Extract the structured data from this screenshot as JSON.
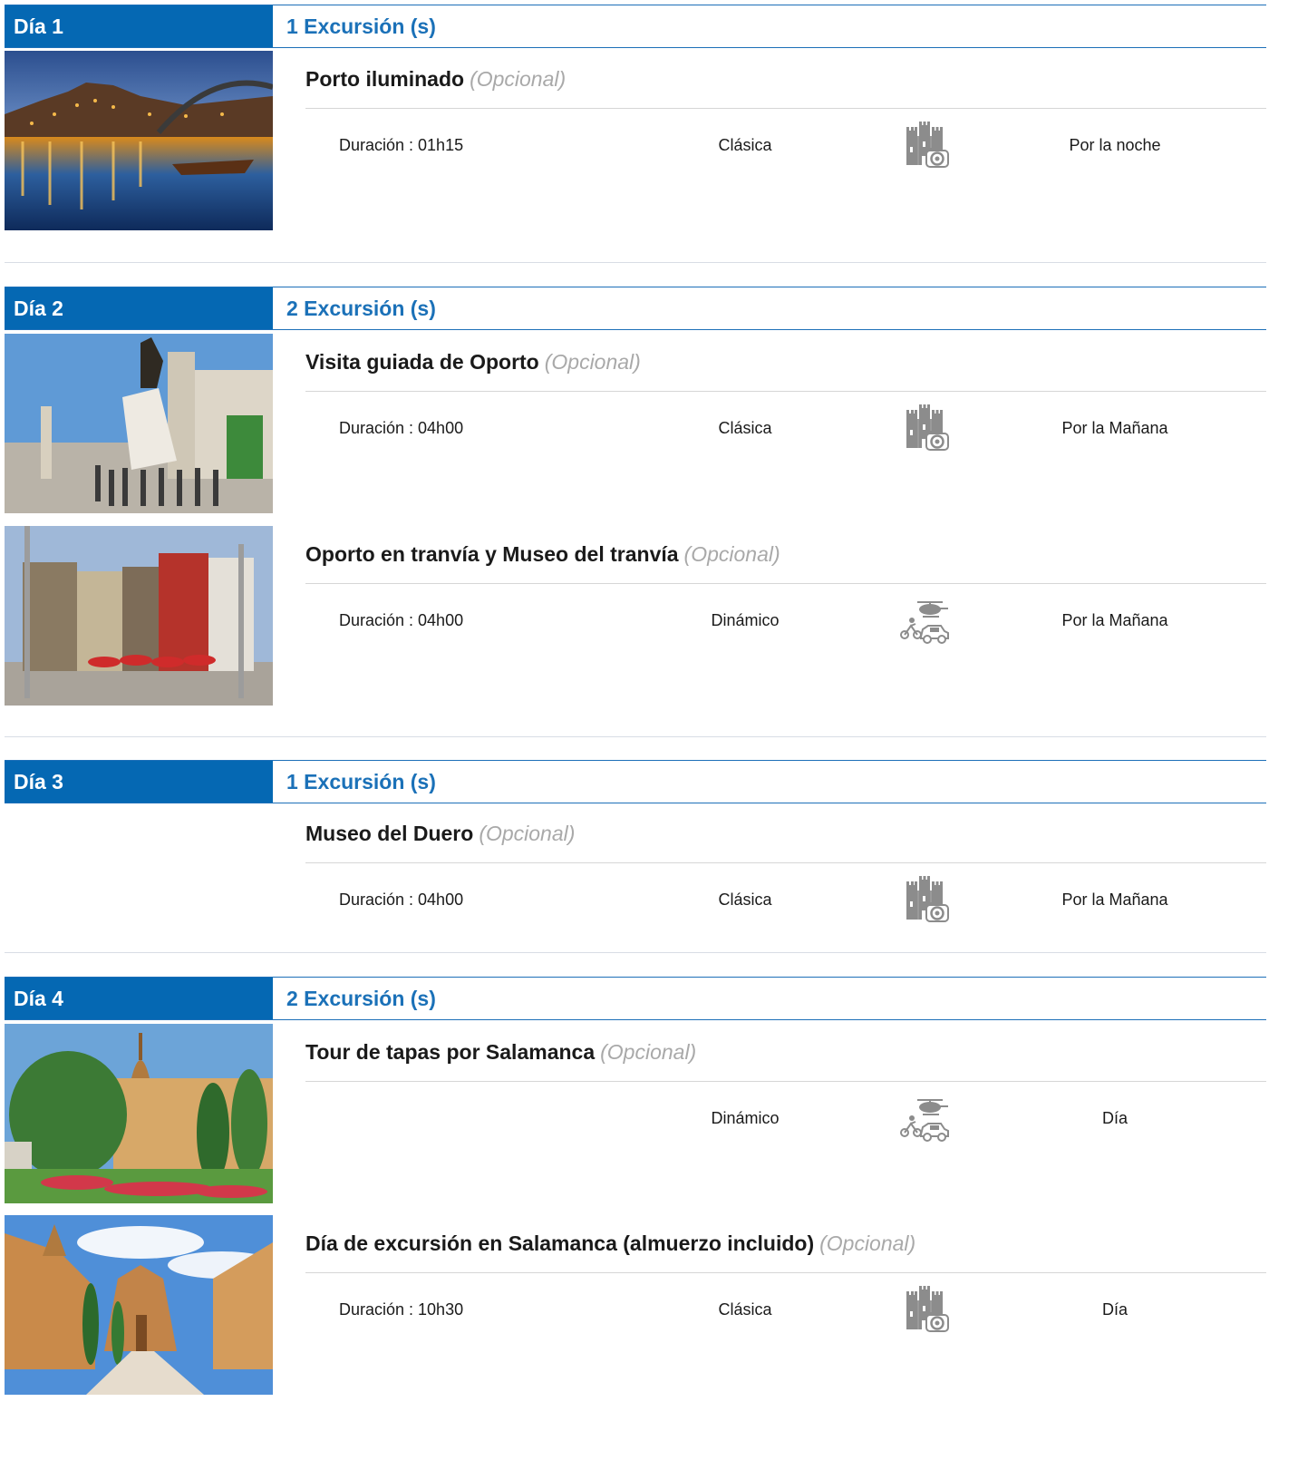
{
  "days": [
    {
      "label": "Día 1",
      "count": "1 Excursión (s)",
      "excursions": [
        {
          "name": "Porto iluminado",
          "optional": "(Opcional)",
          "duration": "Duración : 01h15",
          "category": "Clásica",
          "icon": "castle-camera-icon",
          "time": "Por la noche",
          "image": "porto-night"
        }
      ]
    },
    {
      "label": "Día 2",
      "count": "2 Excursión (s)",
      "excursions": [
        {
          "name": "Visita guiada de Oporto",
          "optional": "(Opcional)",
          "duration": "Duración : 04h00",
          "category": "Clásica",
          "icon": "castle-camera-icon",
          "time": "Por la Mañana",
          "image": "porto-statue"
        },
        {
          "name": "Oporto en tranvía y Museo del tranvía",
          "optional": "(Opcional)",
          "duration": "Duración : 04h00",
          "category": "Dinámico",
          "icon": "adventure-vehicles-icon",
          "time": "Por la Mañana",
          "image": "porto-street"
        }
      ]
    },
    {
      "label": "Día 3",
      "count": "1 Excursión (s)",
      "excursions": [
        {
          "name": "Museo del Duero",
          "optional": "(Opcional)",
          "duration": "Duración : 04h00",
          "category": "Clásica",
          "icon": "castle-camera-icon",
          "time": "Por la Mañana",
          "image": "none"
        }
      ]
    },
    {
      "label": "Día 4",
      "count": "2 Excursión (s)",
      "excursions": [
        {
          "name": "Tour de tapas por Salamanca",
          "optional": "(Opcional)",
          "duration": "",
          "category": "Dinámico",
          "icon": "adventure-vehicles-icon",
          "time": "Día",
          "image": "salamanca-garden"
        },
        {
          "name": "Día de excursión en Salamanca (almuerzo incluido)",
          "optional": "(Opcional)",
          "duration": "Duración : 10h30",
          "category": "Clásica",
          "icon": "castle-camera-icon",
          "time": "Día",
          "image": "salamanca-cathedral"
        }
      ]
    }
  ],
  "colors": {
    "header_bg": "#0568b3",
    "accent_text": "#1b71b8",
    "optional_text": "#a9a9a9",
    "icon_gray": "#8c8c8c"
  }
}
